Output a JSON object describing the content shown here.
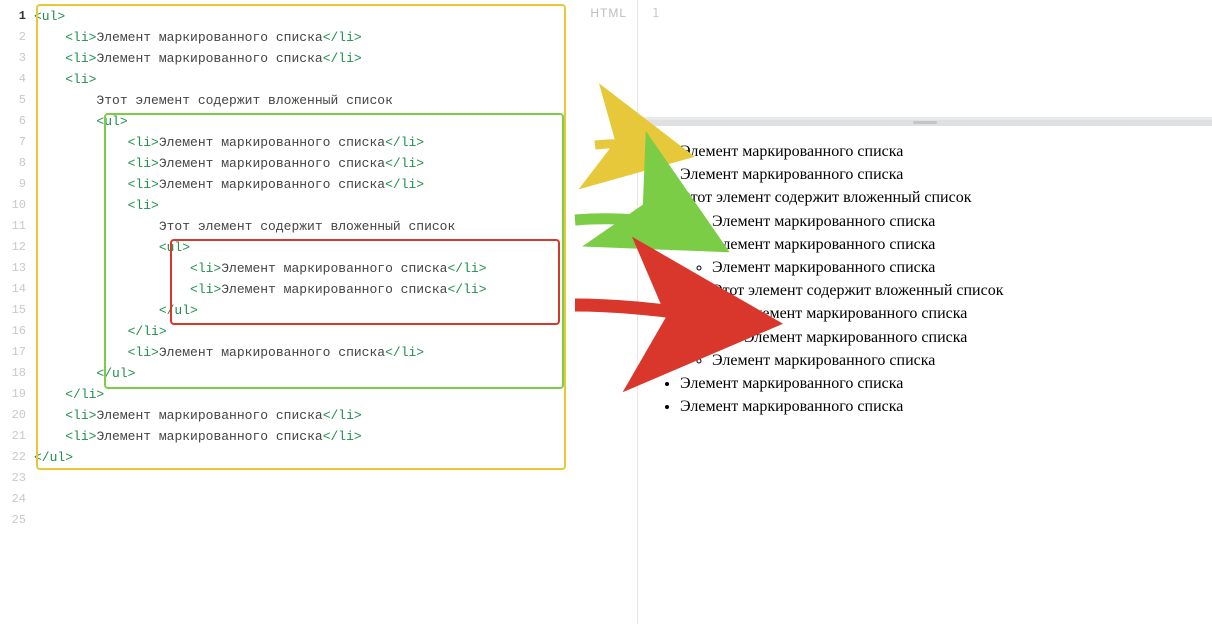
{
  "lang_badge": "HTML",
  "item_text": "Элемент маркированного списка",
  "nested_text": "Этот элемент содержит вложенный список",
  "colors": {
    "yellow": "#e7c83a",
    "green": "#7bcd45",
    "red": "#d9362c"
  },
  "code_lines": [
    {
      "i": 1,
      "indent": 0,
      "parts": [
        {
          "c": "t-tag",
          "t": "<ul>"
        }
      ]
    },
    {
      "i": 2,
      "indent": 1,
      "parts": [
        {
          "c": "t-tag",
          "t": "<li>"
        },
        {
          "c": "t-txt",
          "t": "Элемент маркированного списка"
        },
        {
          "c": "t-tag",
          "t": "</li>"
        }
      ]
    },
    {
      "i": 3,
      "indent": 1,
      "parts": [
        {
          "c": "t-tag",
          "t": "<li>"
        },
        {
          "c": "t-txt",
          "t": "Элемент маркированного списка"
        },
        {
          "c": "t-tag",
          "t": "</li>"
        }
      ]
    },
    {
      "i": 4,
      "indent": 1,
      "parts": [
        {
          "c": "t-tag",
          "t": "<li>"
        }
      ]
    },
    {
      "i": 5,
      "indent": 2,
      "parts": [
        {
          "c": "t-txt",
          "t": "Этот элемент содержит вложенный список"
        }
      ]
    },
    {
      "i": 6,
      "indent": 2,
      "parts": [
        {
          "c": "t-tag",
          "t": "<ul>"
        }
      ]
    },
    {
      "i": 7,
      "indent": 3,
      "parts": [
        {
          "c": "t-tag",
          "t": "<li>"
        },
        {
          "c": "t-txt",
          "t": "Элемент маркированного списка"
        },
        {
          "c": "t-tag",
          "t": "</li>"
        }
      ]
    },
    {
      "i": 8,
      "indent": 3,
      "parts": [
        {
          "c": "t-tag",
          "t": "<li>"
        },
        {
          "c": "t-txt",
          "t": "Элемент маркированного списка"
        },
        {
          "c": "t-tag",
          "t": "</li>"
        }
      ]
    },
    {
      "i": 9,
      "indent": 3,
      "parts": [
        {
          "c": "t-tag",
          "t": "<li>"
        },
        {
          "c": "t-txt",
          "t": "Элемент маркированного списка"
        },
        {
          "c": "t-tag",
          "t": "</li>"
        }
      ]
    },
    {
      "i": 10,
      "indent": 3,
      "parts": [
        {
          "c": "t-tag",
          "t": "<li>"
        }
      ]
    },
    {
      "i": 11,
      "indent": 4,
      "parts": [
        {
          "c": "t-txt",
          "t": "Этот элемент содержит вложенный список"
        }
      ]
    },
    {
      "i": 12,
      "indent": 4,
      "parts": [
        {
          "c": "t-tag",
          "t": "<ul>"
        }
      ]
    },
    {
      "i": 13,
      "indent": 5,
      "parts": [
        {
          "c": "t-tag",
          "t": "<li>"
        },
        {
          "c": "t-txt",
          "t": "Элемент маркированного списка"
        },
        {
          "c": "t-tag",
          "t": "</li>"
        }
      ]
    },
    {
      "i": 14,
      "indent": 5,
      "parts": [
        {
          "c": "t-tag",
          "t": "<li>"
        },
        {
          "c": "t-txt",
          "t": "Элемент маркированного списка"
        },
        {
          "c": "t-tag",
          "t": "</li>"
        }
      ]
    },
    {
      "i": 15,
      "indent": 4,
      "parts": [
        {
          "c": "t-tag",
          "t": "</ul>"
        }
      ]
    },
    {
      "i": 16,
      "indent": 3,
      "parts": [
        {
          "c": "t-tag",
          "t": "</li>"
        }
      ]
    },
    {
      "i": 17,
      "indent": 3,
      "parts": [
        {
          "c": "t-tag",
          "t": "<li>"
        },
        {
          "c": "t-txt",
          "t": "Элемент маркированного списка"
        },
        {
          "c": "t-tag",
          "t": "</li>"
        }
      ]
    },
    {
      "i": 18,
      "indent": 2,
      "parts": [
        {
          "c": "t-tag",
          "t": "</ul>"
        }
      ]
    },
    {
      "i": 19,
      "indent": 1,
      "parts": [
        {
          "c": "t-tag",
          "t": "</li>"
        }
      ]
    },
    {
      "i": 20,
      "indent": 1,
      "parts": [
        {
          "c": "t-tag",
          "t": "<li>"
        },
        {
          "c": "t-txt",
          "t": "Элемент маркированного списка"
        },
        {
          "c": "t-tag",
          "t": "</li>"
        }
      ]
    },
    {
      "i": 21,
      "indent": 1,
      "parts": [
        {
          "c": "t-tag",
          "t": "<li>"
        },
        {
          "c": "t-txt",
          "t": "Элемент маркированного списка"
        },
        {
          "c": "t-tag",
          "t": "</li>"
        }
      ]
    },
    {
      "i": 22,
      "indent": 0,
      "parts": [
        {
          "c": "t-tag",
          "t": "</ul>"
        }
      ]
    },
    {
      "i": 23,
      "indent": 0,
      "parts": []
    },
    {
      "i": 24,
      "indent": 0,
      "parts": []
    },
    {
      "i": 25,
      "indent": 0,
      "parts": []
    }
  ],
  "line_numbers": [
    "1",
    "2",
    "3",
    "4",
    "5",
    "6",
    "7",
    "8",
    "9",
    "10",
    "11",
    "12",
    "13",
    "14",
    "15",
    "16",
    "17",
    "18",
    "19",
    "20",
    "21",
    "22",
    "23",
    "24",
    "25"
  ]
}
